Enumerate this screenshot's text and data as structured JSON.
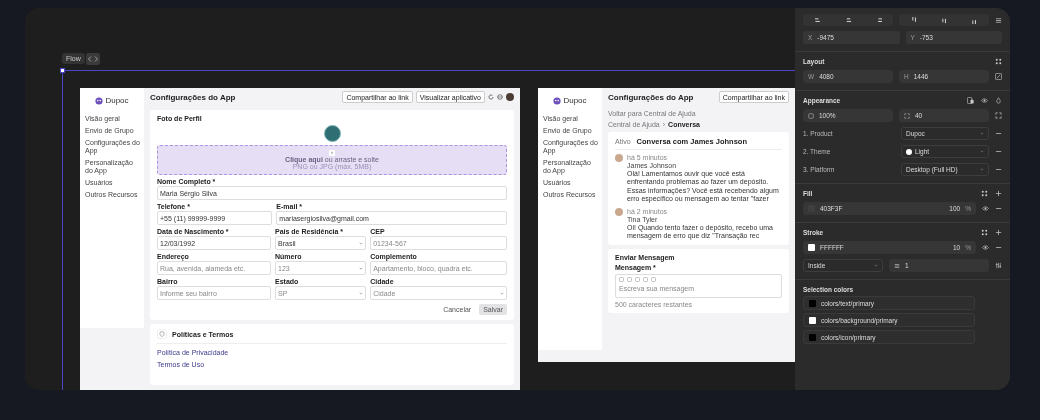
{
  "canvas": {
    "flow_label": "Flow"
  },
  "settings_frame": {
    "brand": "Dupoc",
    "nav": [
      "Visão geral",
      "Envio de Grupo",
      "Configurações do App",
      "Personalização do App",
      "Usuários",
      "Outros Recursos"
    ],
    "title": "Configurações do App",
    "header_buttons": [
      "Compartilhar ao link",
      "Visualizar aplicativo"
    ],
    "photo_section": {
      "title": "Foto de Perfil",
      "upload_text": "**Clique aqui** ou arraste e solte",
      "upload_hint": "PNG ou JPG (máx. 5MB)"
    },
    "field_rows": [
      [
        {
          "label": "Nome Completo *",
          "value": "Maria Sérgio Silva",
          "kind": "text"
        }
      ],
      [
        {
          "label": "Telefone *",
          "value": "+55 (11) 99999-9999",
          "kind": "text"
        },
        {
          "label": "E-mail *",
          "value": "mariasergiosilva@gmail.com",
          "kind": "text"
        }
      ],
      [
        {
          "label": "Data de Nascimento *",
          "value": "12/03/1992",
          "kind": "text"
        },
        {
          "label": "País de Residência *",
          "value": "Brasil",
          "kind": "select"
        },
        {
          "label": "CEP",
          "placeholder": "01234-567",
          "kind": "text"
        }
      ],
      [
        {
          "label": "Endereço",
          "placeholder": "Rua, avenida, alameda etc.",
          "kind": "text"
        },
        {
          "label": "Número",
          "placeholder": "123",
          "kind": "select"
        },
        {
          "label": "Complemento",
          "placeholder": "Apartamento, bloco, quadra etc.",
          "kind": "text"
        }
      ],
      [
        {
          "label": "Bairro",
          "placeholder": "Informe seu bairro",
          "kind": "text"
        },
        {
          "label": "Estado",
          "placeholder": "SP",
          "kind": "select"
        },
        {
          "label": "Cidade",
          "placeholder": "Cidade",
          "kind": "select"
        }
      ]
    ],
    "buttons": [
      "Cancelar",
      "Salvar"
    ],
    "policies": {
      "title": "Políticas e Termos",
      "links": [
        "Política de Privacidade",
        "Termos de Uso"
      ]
    }
  },
  "chat_frame": {
    "brand": "Dupoc",
    "nav": [
      "Visão geral",
      "Envio de Grupo",
      "Configurações do App",
      "Personalização do App",
      "Usuários",
      "Outros Recursos"
    ],
    "title": "Configurações do App",
    "header_button": "Compartilhar ao link",
    "back_link": "Voltar para Central de Ajuda",
    "breadcrumb": [
      "Central de Ajuda",
      "Conversa"
    ],
    "breadcrumb_separator": "›",
    "conversation": {
      "status": "Ativo",
      "title": "Conversa com James Johnson",
      "messages": [
        {
          "time": "há 5 minutos",
          "author": "James Johnson",
          "text": "Olá! Lamentamos ouvir que você está enfrentando problemas ao fazer um depósito. Essas informações? Você está recebendo algum erro específico ou mensagem ao tentar \"fazer"
        },
        {
          "time": "há 2 minutos",
          "author": "Tina Tyler",
          "text": "Oi! Quando tento fazer o depósito, recebo uma mensagem de erro que diz \"Transação rec"
        }
      ]
    },
    "compose": {
      "title": "Enviar Mensagem",
      "label": "Mensagem *",
      "placeholder": "Escreva sua mensagem",
      "counter": "500 caracteres restantes"
    }
  },
  "panel": {
    "position": [
      {
        "label": "X",
        "value": "-9475"
      },
      {
        "label": "Y",
        "value": "-753"
      }
    ],
    "layout": {
      "title": "Layout",
      "size": [
        {
          "label": "W",
          "value": "4080"
        },
        {
          "label": "H",
          "value": "1446"
        }
      ]
    },
    "appearance": {
      "title": "Appearance",
      "opacity": "100%",
      "radius": "40",
      "variables": [
        {
          "label": "1. Product",
          "value": "Dupoc"
        },
        {
          "label": "2. Theme",
          "value": "Light",
          "color": "#ffffff"
        },
        {
          "label": "3. Platform",
          "value": "Desktop (Full HD)"
        }
      ]
    },
    "fill": {
      "title": "Fill",
      "hex": "403F3F",
      "color": "#403f3f",
      "opacity": "100",
      "unit": "%"
    },
    "stroke": {
      "title": "Stroke",
      "hex": "FFFFFF",
      "color": "#ffffff",
      "opacity": "10",
      "unit": "%",
      "position": "Inside",
      "weight": "1"
    },
    "selection_colors": {
      "title": "Selection colors",
      "items": [
        {
          "name": "colors/text/primary",
          "color": "#000000"
        },
        {
          "name": "colors/background/primary",
          "color": "#ffffff"
        },
        {
          "name": "colors/icon/primary",
          "color": "#000000"
        }
      ]
    }
  }
}
